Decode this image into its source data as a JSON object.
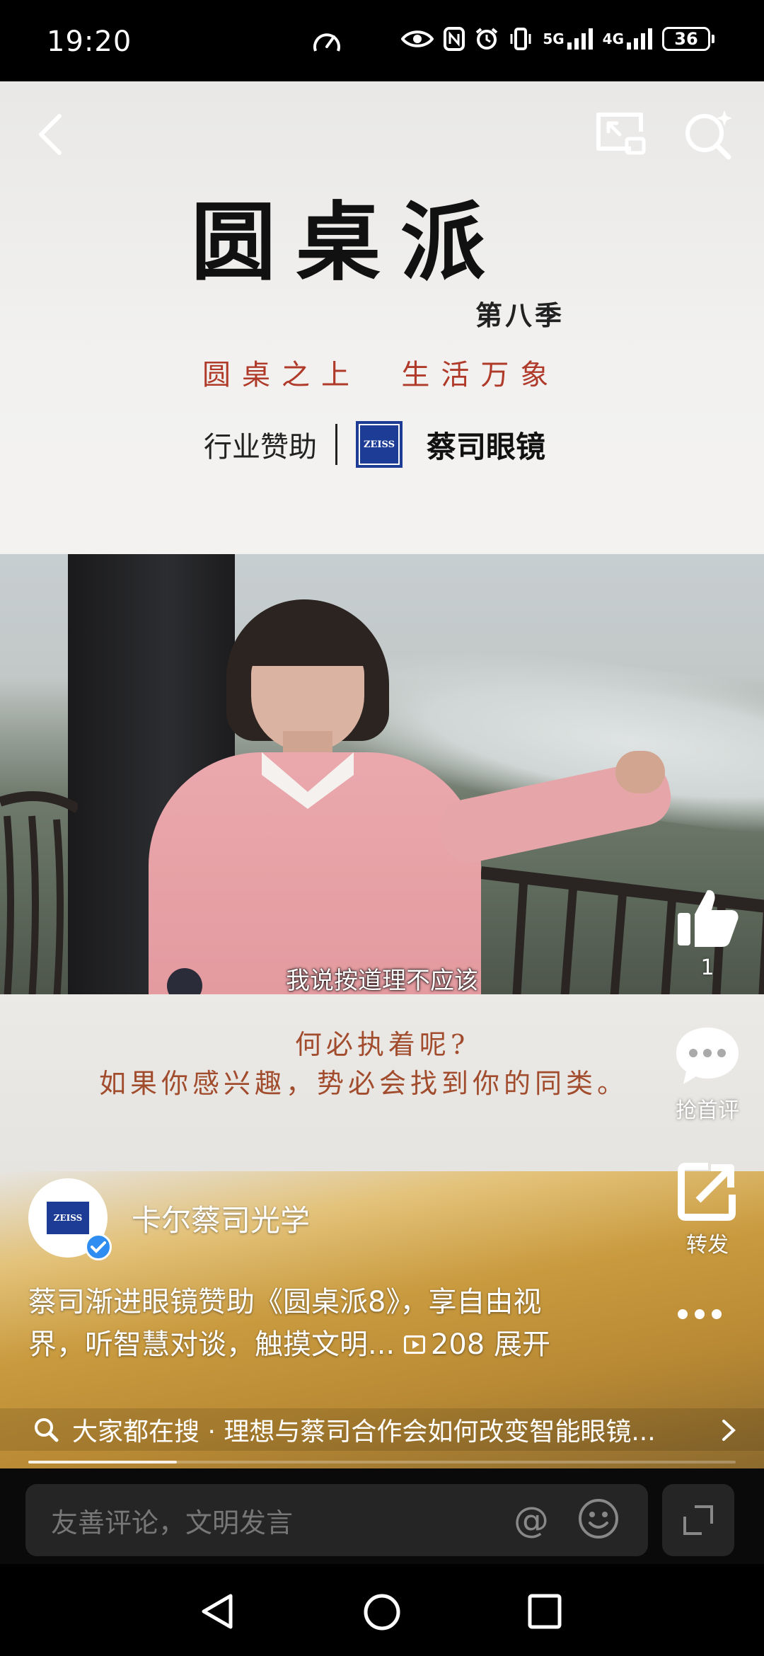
{
  "status_bar": {
    "time": "19:20",
    "network1": "5G",
    "network2": "4G",
    "battery": "36"
  },
  "video": {
    "show_title": "圆桌派",
    "season": "第八季",
    "slogan": "圆桌之上  生活万象",
    "sponsor_label": "行业赞助",
    "sponsor_logo_text": "ZEISS",
    "sponsor_brand": "蔡司眼镜",
    "subtitle": "我说按道理不应该",
    "quote_line1": "何必执着呢?",
    "quote_line2": "如果你感兴趣，势必会找到你的同类。"
  },
  "actions": {
    "like_count": "1",
    "comment_label": "抢首评",
    "share_label": "转发"
  },
  "author": {
    "avatar_logo_text": "ZEISS",
    "name": "卡尔蔡司光学"
  },
  "caption": {
    "line1": "蔡司渐进眼镜赞助《圆桌派8》，享自由视",
    "line2": "界，听智慧对谈，触摸文明...",
    "play_count": "208",
    "expand": "展开"
  },
  "search_suggestion": {
    "text": "大家都在搜 · 理想与蔡司合作会如何改变智能眼镜..."
  },
  "playback": {
    "progress": 0.21
  },
  "comment_bar": {
    "placeholder": "友善评论，文明发言"
  },
  "colors": {
    "accent_blue": "#1c3c96",
    "quote_red": "#a24c2e",
    "verified_blue": "#2f8cf0"
  }
}
